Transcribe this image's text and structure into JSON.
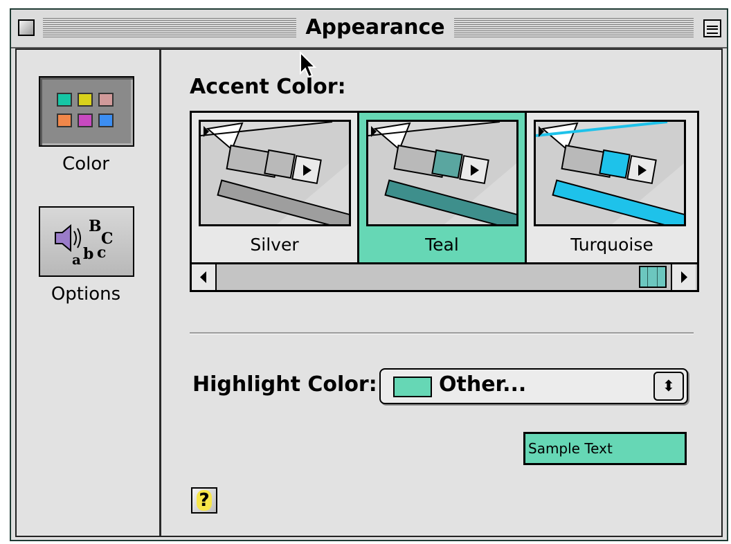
{
  "window": {
    "title": "Appearance"
  },
  "sidebar": {
    "items": [
      {
        "label": "Color",
        "icon": "color-swatches-icon",
        "selected": true
      },
      {
        "label": "Options",
        "icon": "sound-text-icon",
        "icon_text": "ᴮ C a b c",
        "selected": false
      }
    ],
    "color_icon_swatches": [
      "#16c6a5",
      "#d9d11b",
      "#d19a9a",
      "#f0874a",
      "#c84ac0",
      "#3c8ef2"
    ]
  },
  "accent": {
    "heading": "Accent Color:",
    "options": [
      {
        "label": "Silver",
        "color": "#b9b9b9",
        "selected": false
      },
      {
        "label": "Teal",
        "color": "#5aa6a0",
        "selected": true
      },
      {
        "label": "Turquoise",
        "color": "#1ec2ea",
        "selected": false
      }
    ]
  },
  "highlight": {
    "label": "Highlight Color:",
    "value": "Other...",
    "color": "#66d7b5",
    "arrows": "⬍"
  },
  "sample_text": "Sample Text",
  "help": {
    "label": "?"
  },
  "colors": {
    "selected": "#66d7b5",
    "window_bg": "#e2e2e2"
  }
}
